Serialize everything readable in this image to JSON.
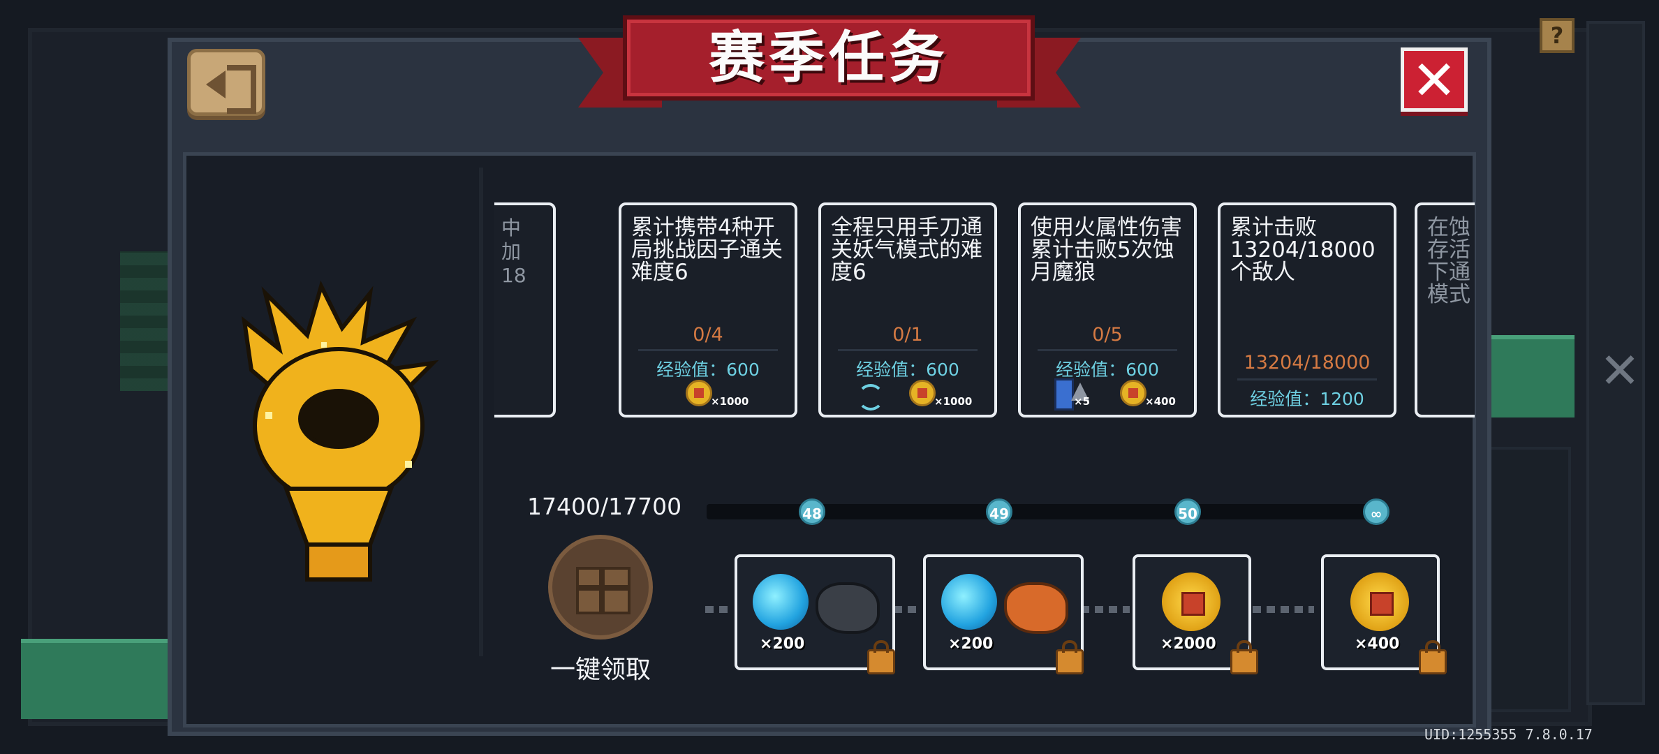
{
  "window": {
    "title": "赛季任务",
    "uid": "UID:1255355 7.8.0.17",
    "help": "?"
  },
  "buttons": {
    "close_symbol": "✕",
    "bg_close_symbol": "✕"
  },
  "tasks": [
    {
      "desc_partial": "中\n加\n18"
    },
    {
      "desc": "累计携带4种开局挑战因子通关难度6",
      "progress": "0/4",
      "exp": "经验值：600",
      "reward_qty": "×1000"
    },
    {
      "desc": "全程只用手刀通关妖气模式的难度6",
      "progress": "0/1",
      "exp": "经验值：600",
      "reward_qty": "×1000"
    },
    {
      "desc": "使用火属性伤害累计击败5次蚀月魔狼",
      "progress": "0/5",
      "exp": "经验值：600",
      "reward_qty_1": "×5",
      "reward_qty_2": "×400"
    },
    {
      "desc": "累计击败13204/18000个敌人",
      "progress": "13204/18000",
      "exp": "经验值：1200"
    },
    {
      "desc_partial": "在蚀\n存活\n下通\n模式"
    }
  ],
  "season": {
    "exp_total": "17400/17700",
    "levels": [
      "48",
      "49",
      "50",
      "∞"
    ],
    "claim_all_label": "一键领取",
    "rewards": [
      {
        "qty": "×200",
        "items": [
          "gem-icon",
          "ore-icon"
        ]
      },
      {
        "qty": "×200",
        "items": [
          "gem-icon",
          "amber-ore-icon"
        ]
      },
      {
        "qty": "×2000",
        "items": [
          "coin-icon"
        ]
      },
      {
        "qty": "×400",
        "items": [
          "coin-icon"
        ]
      }
    ]
  },
  "colors": {
    "progress_text": "#d57a43",
    "exp_text": "#6ed0e2",
    "banner": "#a51f2c",
    "close_button": "#cc2133"
  }
}
